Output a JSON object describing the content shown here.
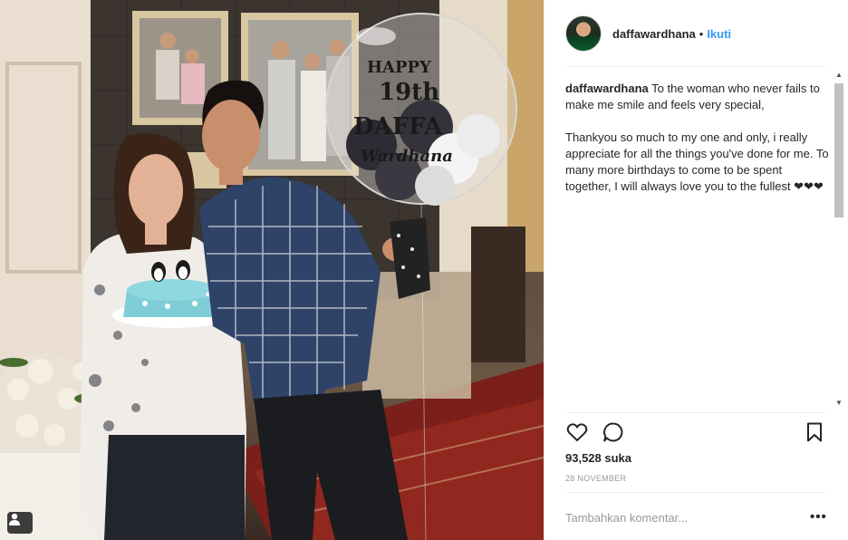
{
  "post": {
    "username": "daffawardhana",
    "follow_label": "Ikuti",
    "separator": "•",
    "caption_paragraphs": [
      "To the woman who never fails to make me smile and feels very special,",
      "Thankyou so much to my one and only, i really appreciate for all the things you've done for me. To many more birthdays to come to be spent together, I will always love you to the fullest ❤❤❤"
    ],
    "likes": "93,528 suka",
    "date": "28 NOVEMBER",
    "comment_placeholder": "Tambahkan komentar...",
    "more_label": "•••"
  },
  "photo": {
    "balloon_text": [
      "HAPPY",
      "19th",
      "DAFFA",
      "Wardhana"
    ]
  },
  "icons": {
    "like": "heart-icon",
    "comment": "comment-icon",
    "save": "bookmark-icon",
    "tag": "user-tag-icon",
    "more": "more-options-icon"
  },
  "colors": {
    "link": "#3897f0",
    "text": "#262626",
    "muted": "#999999",
    "border": "#efefef"
  }
}
